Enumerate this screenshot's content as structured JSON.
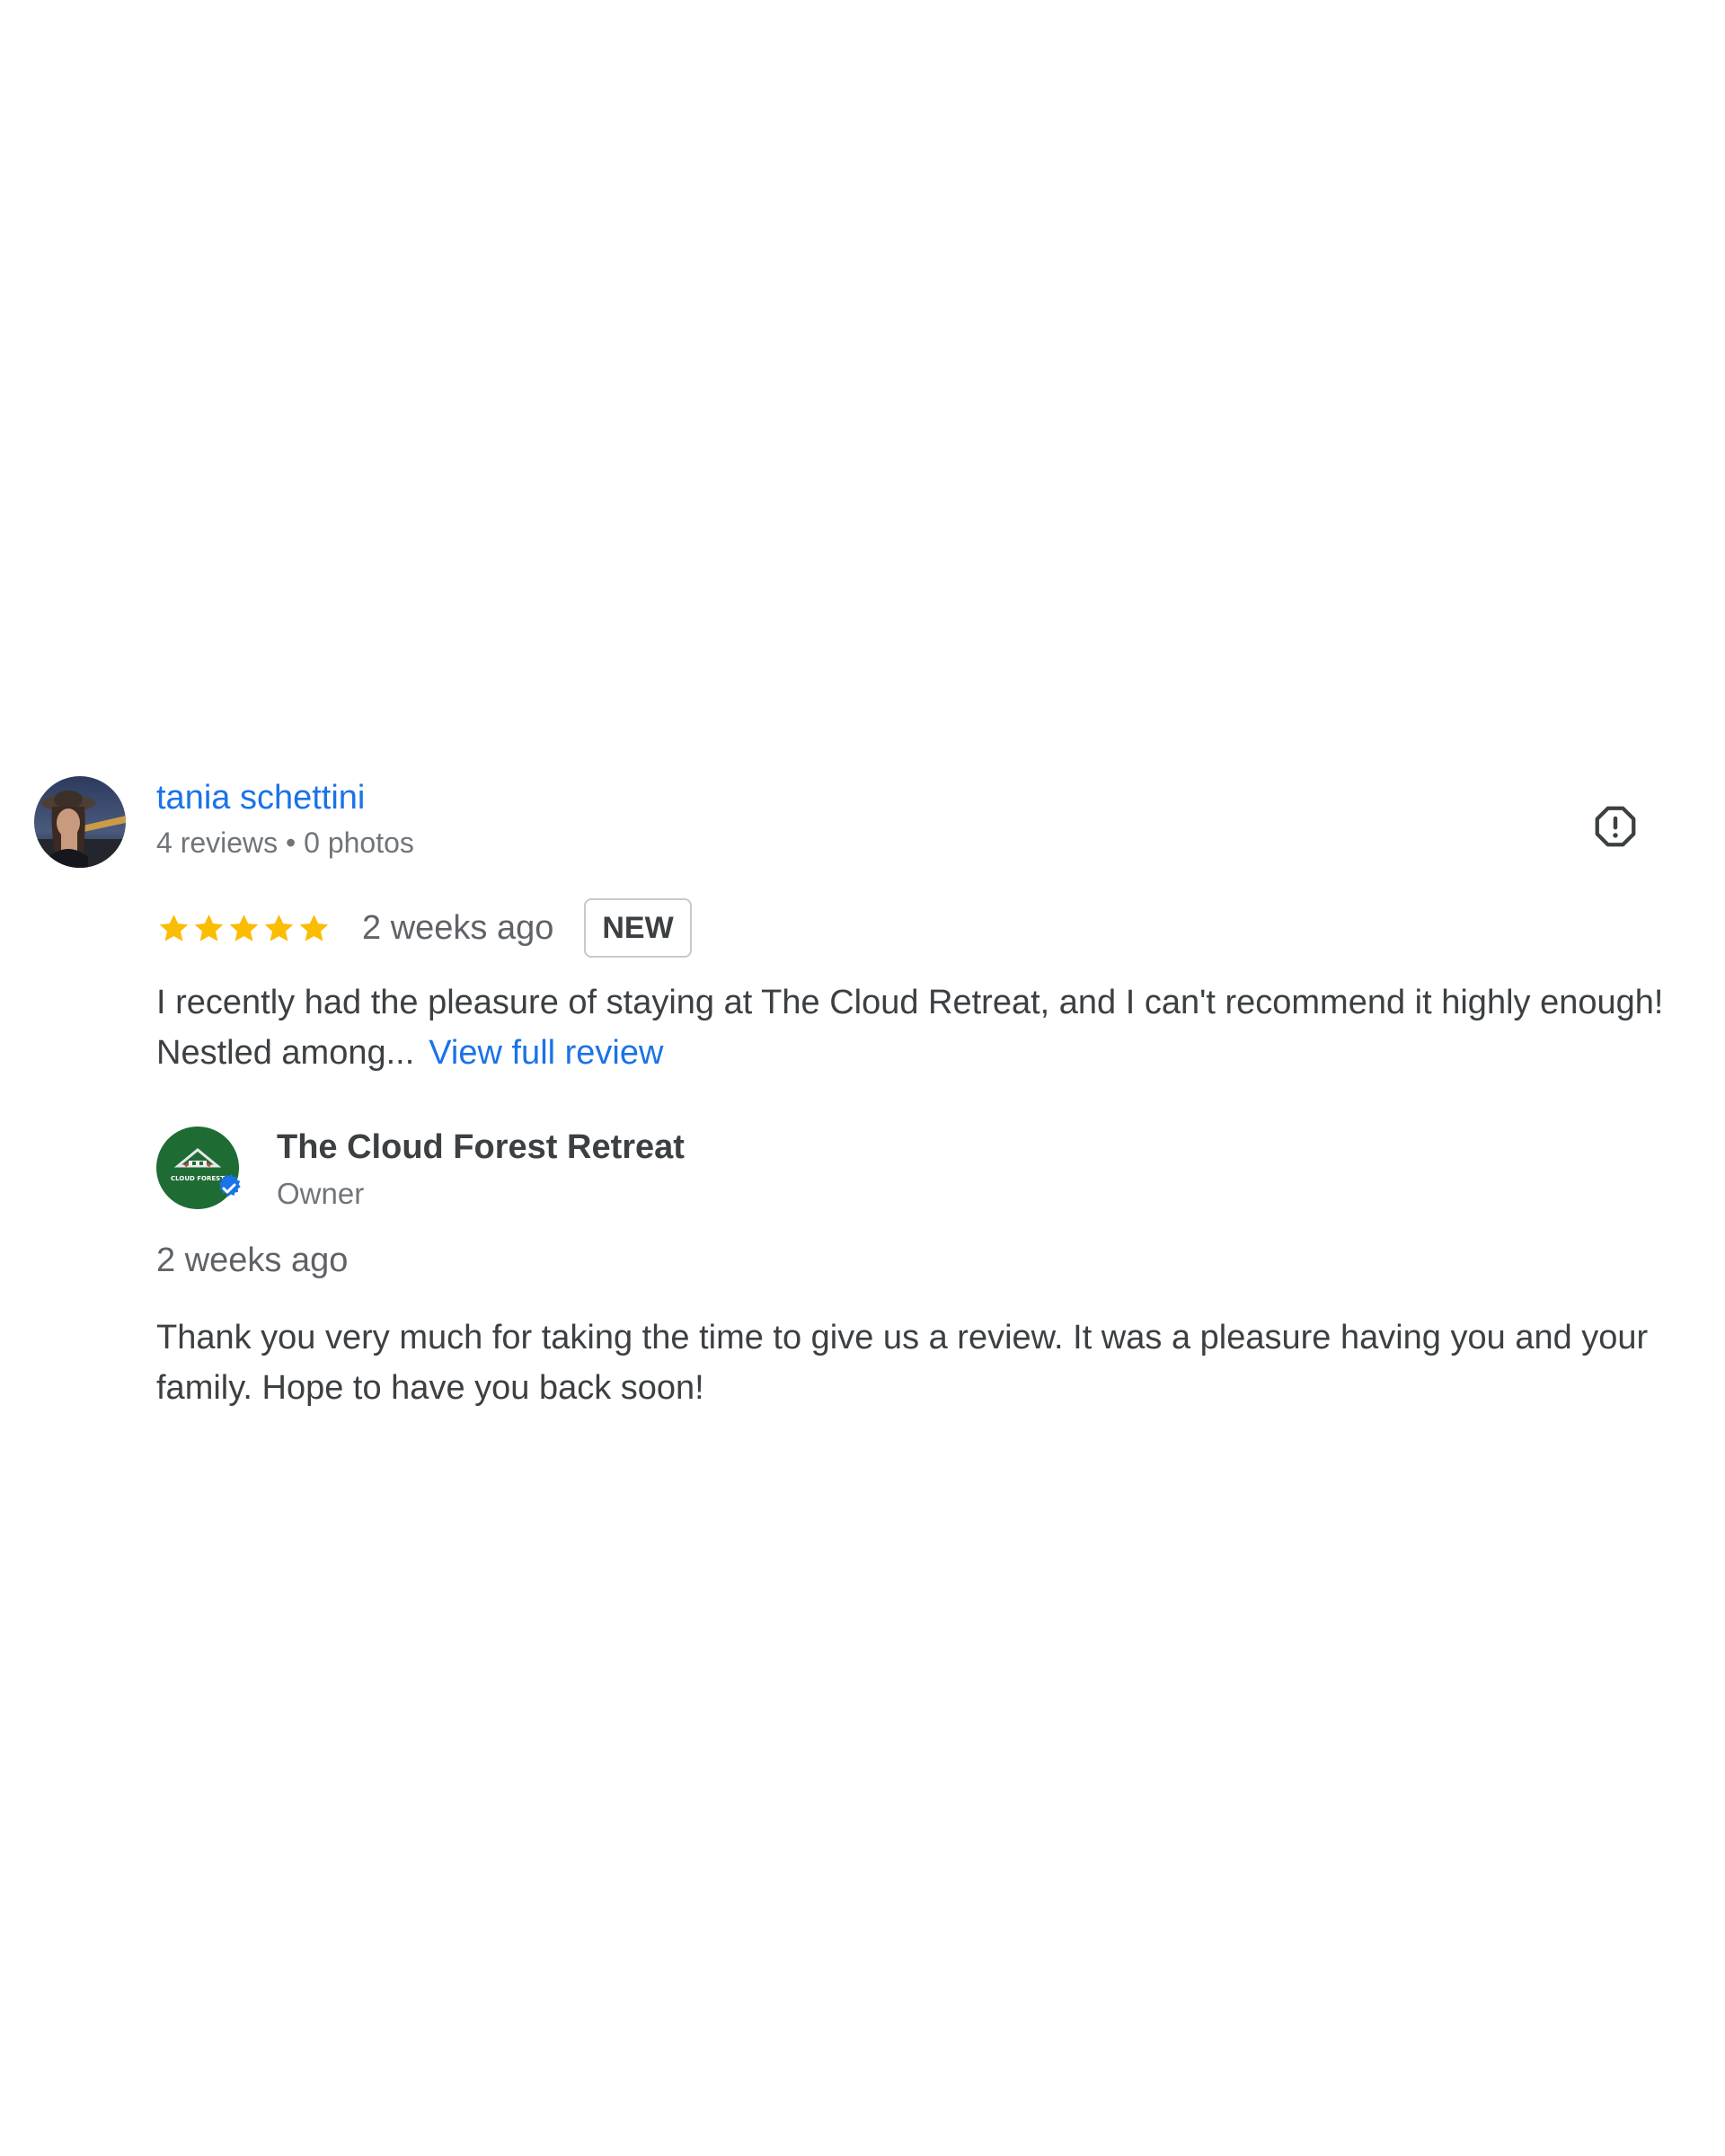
{
  "review": {
    "reviewer_name": "tania schettini",
    "reviewer_meta": "4 reviews • 0 photos",
    "rating": 5,
    "time_ago": "2 weeks ago",
    "badge": "NEW",
    "text": "I recently had the pleasure of staying at The Cloud Retreat, and I can't recommend it highly enough! Nestled among...",
    "view_full_label": "View full review",
    "star_color": "#fbbc04",
    "icons": {
      "report": "report-flag-icon",
      "star": "star-icon"
    }
  },
  "owner_response": {
    "name": "The Cloud Forest Retreat",
    "role": "Owner",
    "time_ago": "2 weeks ago",
    "text": "Thank you very much for taking the time to give us a review. It was a pleasure having you and your family. Hope to have you back soon!",
    "logo_text": "CLOUD FOREST",
    "verified_color": "#1a73e8",
    "logo_color": "#1e6b34"
  }
}
